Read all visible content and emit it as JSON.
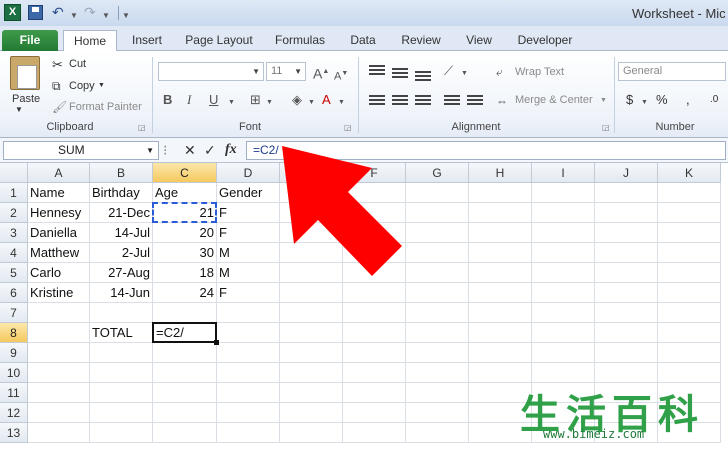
{
  "window": {
    "title": "Worksheet - Mic"
  },
  "quick_access": {
    "app_icon": "excel-logo",
    "letter": "X",
    "save_icon": "save-icon",
    "undo_icon": "undo-icon",
    "redo_icon": "redo-icon"
  },
  "tabs": [
    {
      "label": "File",
      "active": false
    },
    {
      "label": "Home",
      "active": true
    },
    {
      "label": "Insert"
    },
    {
      "label": "Page Layout"
    },
    {
      "label": "Formulas"
    },
    {
      "label": "Data"
    },
    {
      "label": "Review"
    },
    {
      "label": "View"
    },
    {
      "label": "Developer"
    }
  ],
  "ribbon": {
    "clipboard": {
      "label": "Clipboard",
      "paste": "Paste",
      "cut": "Cut",
      "copy": "Copy",
      "format_painter": "Format Painter"
    },
    "font": {
      "label": "Font",
      "font_name": "",
      "font_size": "11",
      "bold": "B",
      "italic": "I",
      "underline": "U"
    },
    "alignment": {
      "label": "Alignment",
      "wrap_text": "Wrap Text",
      "merge_center": "Merge & Center"
    },
    "number": {
      "label": "Number",
      "format": "General",
      "currency": "$",
      "percent": "%",
      "comma": ","
    }
  },
  "formula_bar": {
    "name_box": "SUM",
    "cancel": "✕",
    "enter": "✓",
    "fx": "fx",
    "formula": "=C2/"
  },
  "columns": [
    "A",
    "B",
    "C",
    "D",
    "E",
    "F",
    "G",
    "H",
    "I",
    "J",
    "K"
  ],
  "rows": [
    "1",
    "2",
    "3",
    "4",
    "5",
    "6",
    "7",
    "8",
    "9",
    "10",
    "11",
    "12",
    "13"
  ],
  "selected_column": "C",
  "selected_row": "8",
  "cells": {
    "A1": "Name",
    "B1": "Birthday",
    "C1": "Age",
    "D1": "Gender",
    "A2": "Hennesy",
    "B2": "21-Dec",
    "C2": "21",
    "D2": "F",
    "A3": "Daniella",
    "B3": "14-Jul",
    "C3": "20",
    "D3": "F",
    "A4": "Matthew",
    "B4": "2-Jul",
    "C4": "30",
    "D4": "M",
    "A5": "Carlo",
    "B5": "27-Aug",
    "C5": "18",
    "D5": "M",
    "A6": "Kristine",
    "B6": "14-Jun",
    "C6": "24",
    "D6": "F",
    "B8": "TOTAL",
    "C8": "=C2/"
  },
  "annotation": {
    "arrow_color": "#ff0000"
  },
  "watermark": {
    "text": "生活百科",
    "url": "www.bimeiz.com"
  }
}
